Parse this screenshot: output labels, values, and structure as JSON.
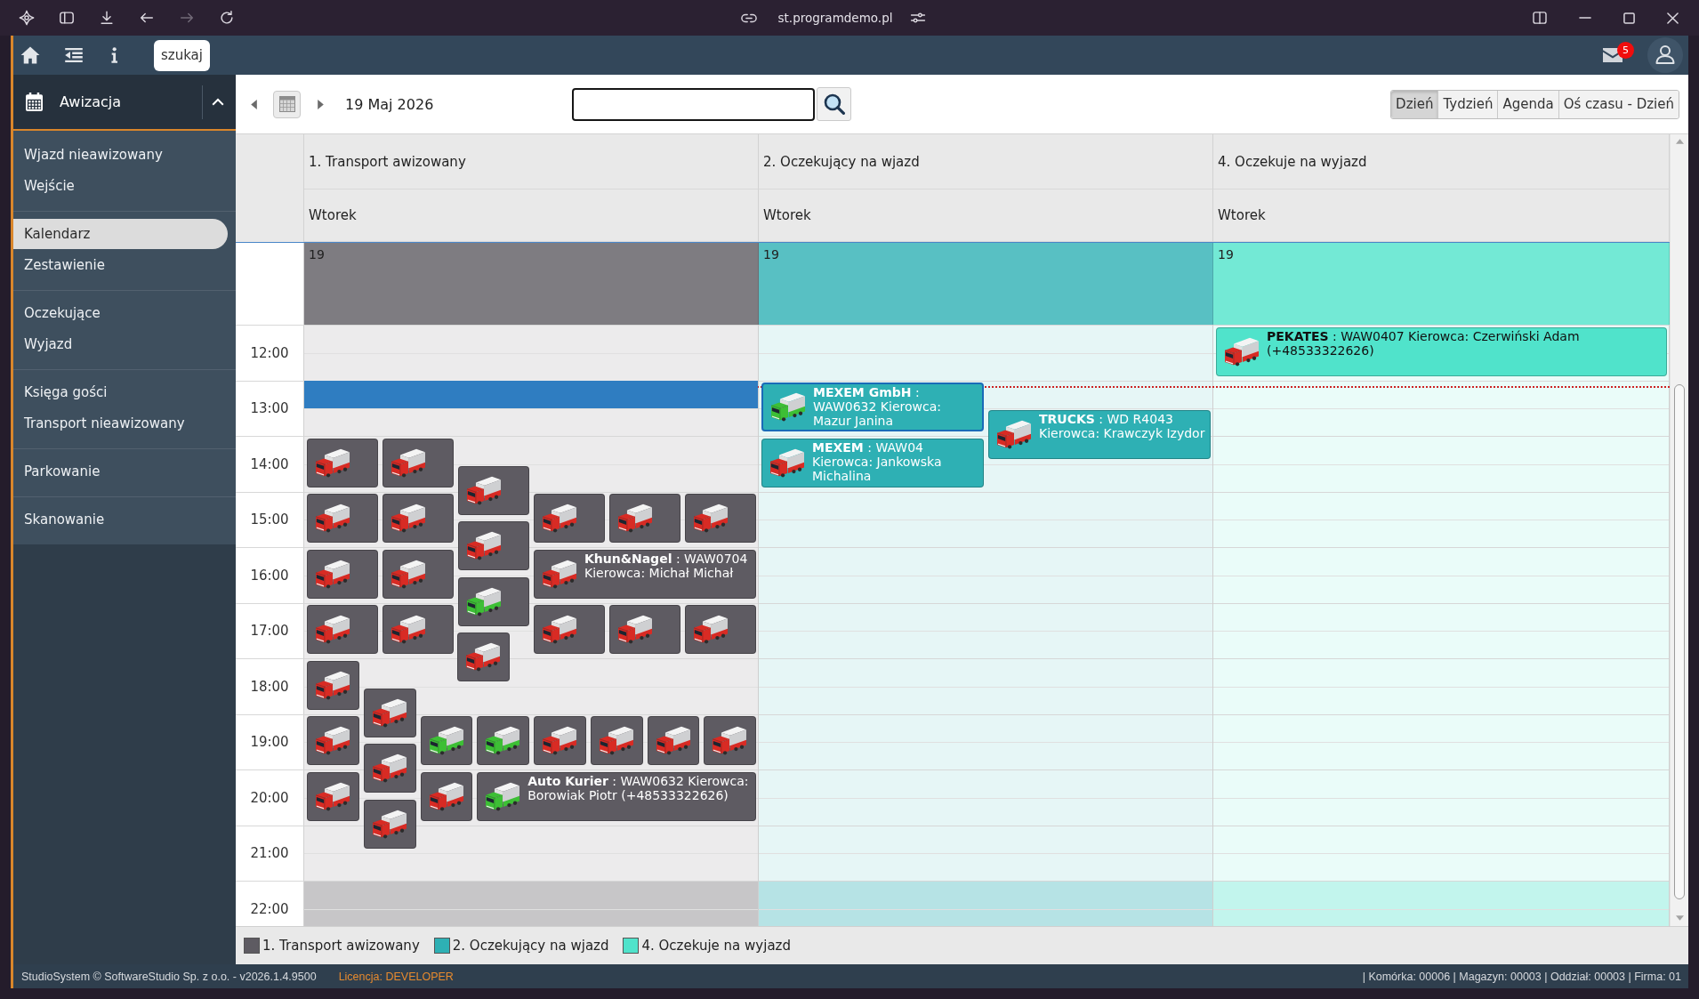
{
  "browser": {
    "url": "st.programdemo.pl",
    "forward_disabled": true
  },
  "topbar": {
    "search_button": "szukaj",
    "mail_badge": "5"
  },
  "sidebar": {
    "section": {
      "label": "Awizacja",
      "expanded": true
    },
    "groups": [
      {
        "items": [
          {
            "label": "Wjazd nieawizowany",
            "selected": false
          },
          {
            "label": "Wejście",
            "selected": false
          }
        ]
      },
      {
        "items": [
          {
            "label": "Kalendarz",
            "selected": true
          },
          {
            "label": "Zestawienie",
            "selected": false
          }
        ]
      },
      {
        "items": [
          {
            "label": "Oczekujące",
            "selected": false
          },
          {
            "label": "Wyjazd",
            "selected": false
          }
        ]
      },
      {
        "items": [
          {
            "label": "Księga gości",
            "selected": false
          },
          {
            "label": "Transport nieawizowany",
            "selected": false
          }
        ]
      },
      {
        "items": [
          {
            "label": "Parkowanie",
            "selected": false
          }
        ]
      },
      {
        "items": [
          {
            "label": "Skanowanie",
            "selected": false
          }
        ]
      }
    ]
  },
  "toolbar": {
    "date": "19 Maj 2026",
    "views": [
      {
        "label": "Dzień",
        "selected": true
      },
      {
        "label": "Tydzień",
        "selected": false
      },
      {
        "label": "Agenda",
        "selected": false
      },
      {
        "label": "Oś czasu - Dzień",
        "selected": false
      }
    ]
  },
  "calendar": {
    "current_time_line": true,
    "off_hours_shaded": true,
    "hours": [
      "12:00",
      "13:00",
      "14:00",
      "15:00",
      "16:00",
      "17:00",
      "18:00",
      "19:00",
      "20:00",
      "21:00",
      "22:00"
    ],
    "columns": [
      {
        "title": "1. Transport awizowany",
        "day": "Wtorek",
        "date": "19",
        "color": "#5e5b62",
        "slot_selected": true,
        "events": [
          {
            "color": "#d82b24",
            "selected": false
          },
          {
            "color": "#d82b24",
            "selected": false
          },
          {
            "color": "#d82b24",
            "selected": false
          },
          {
            "color": "#d82b24",
            "selected": false
          },
          {
            "color": "#d82b24",
            "selected": false
          },
          {
            "color": "#d82b24",
            "selected": false
          },
          {
            "color": "#d82b24",
            "selected": false
          },
          {
            "color": "#d82b24",
            "selected": false
          },
          {
            "color": "#d82b24",
            "selected": false
          },
          {
            "color": "#d82b24",
            "selected": false
          },
          {
            "color": "#d82b24",
            "selected": false
          },
          {
            "color": "#d82b24",
            "selected": false,
            "text": "**Khun&Nagel** : WAW0704 Kierowca: Michał Michał"
          },
          {
            "color": "#3dbf35",
            "selected": false
          },
          {
            "color": "#d82b24",
            "selected": false
          },
          {
            "color": "#d82b24",
            "selected": false
          },
          {
            "color": "#d82b24",
            "selected": false
          },
          {
            "color": "#d82b24",
            "selected": false
          },
          {
            "color": "#d82b24",
            "selected": false
          },
          {
            "color": "#d82b24",
            "selected": false
          },
          {
            "color": "#d82b24",
            "selected": false
          },
          {
            "color": "#d82b24",
            "selected": false
          },
          {
            "color": "#d82b24",
            "selected": false
          },
          {
            "color": "#3dbf35",
            "selected": false
          },
          {
            "color": "#3dbf35",
            "selected": false
          },
          {
            "color": "#d82b24",
            "selected": false
          },
          {
            "color": "#d82b24",
            "selected": false
          },
          {
            "color": "#d82b24",
            "selected": false
          },
          {
            "color": "#d82b24",
            "selected": false
          },
          {
            "color": "#d82b24",
            "selected": false
          },
          {
            "color": "#d82b24",
            "selected": false
          },
          {
            "color": "#d82b24",
            "selected": false
          },
          {
            "color": "#3dbf35",
            "selected": false,
            "text": "**Auto Kurier** : WAW0632 Kierowca: Borowiak Piotr (+48533322626)"
          },
          {
            "color": "#d82b24",
            "selected": false
          }
        ]
      },
      {
        "title": "2. Oczekujący na wjazd",
        "day": "Wtorek",
        "date": "19",
        "color": "#2eb0b4",
        "slot_selected": false,
        "events": [
          {
            "color": "#3dbf35",
            "selected": true,
            "text": "**MEXEM GmbH** : WAW0632 Kierowca: Mazur Janina"
          },
          {
            "color": "#d82b24",
            "selected": false,
            "text": "**TRUCKS** : WD R4043 Kierowca: Krawczyk Izydor"
          },
          {
            "color": "#d82b24",
            "selected": false,
            "text": "**MEXEM** : WAW04 Kierowca: Jankowska Michalina"
          }
        ]
      },
      {
        "title": "4. Oczekuje na wyjazd",
        "day": "Wtorek",
        "date": "19",
        "color": "#50e3cb",
        "slot_selected": false,
        "events": [
          {
            "color": "#d82b24",
            "selected": false,
            "text": "**PEKATES** : WAW0407 Kierowca: Czerwiński Adam (+48533322626)"
          }
        ]
      }
    ]
  },
  "legend": [
    {
      "label": "1. Transport awizowany",
      "color": "#5e5b62"
    },
    {
      "label": "2. Oczekujący na wjazd",
      "color": "#2eb0b4"
    },
    {
      "label": "4. Oczekuje na wyjazd",
      "color": "#50e3cb"
    }
  ],
  "footer": {
    "copyright": "StudioSystem © SoftwareStudio Sp. z o.o. - v2026.1.4.9500",
    "license": "Licencja: DEVELOPER",
    "location": "| Komórka: 00006 | Magazyn: 00003 | Oddział: 00003 | Firma: 01"
  }
}
